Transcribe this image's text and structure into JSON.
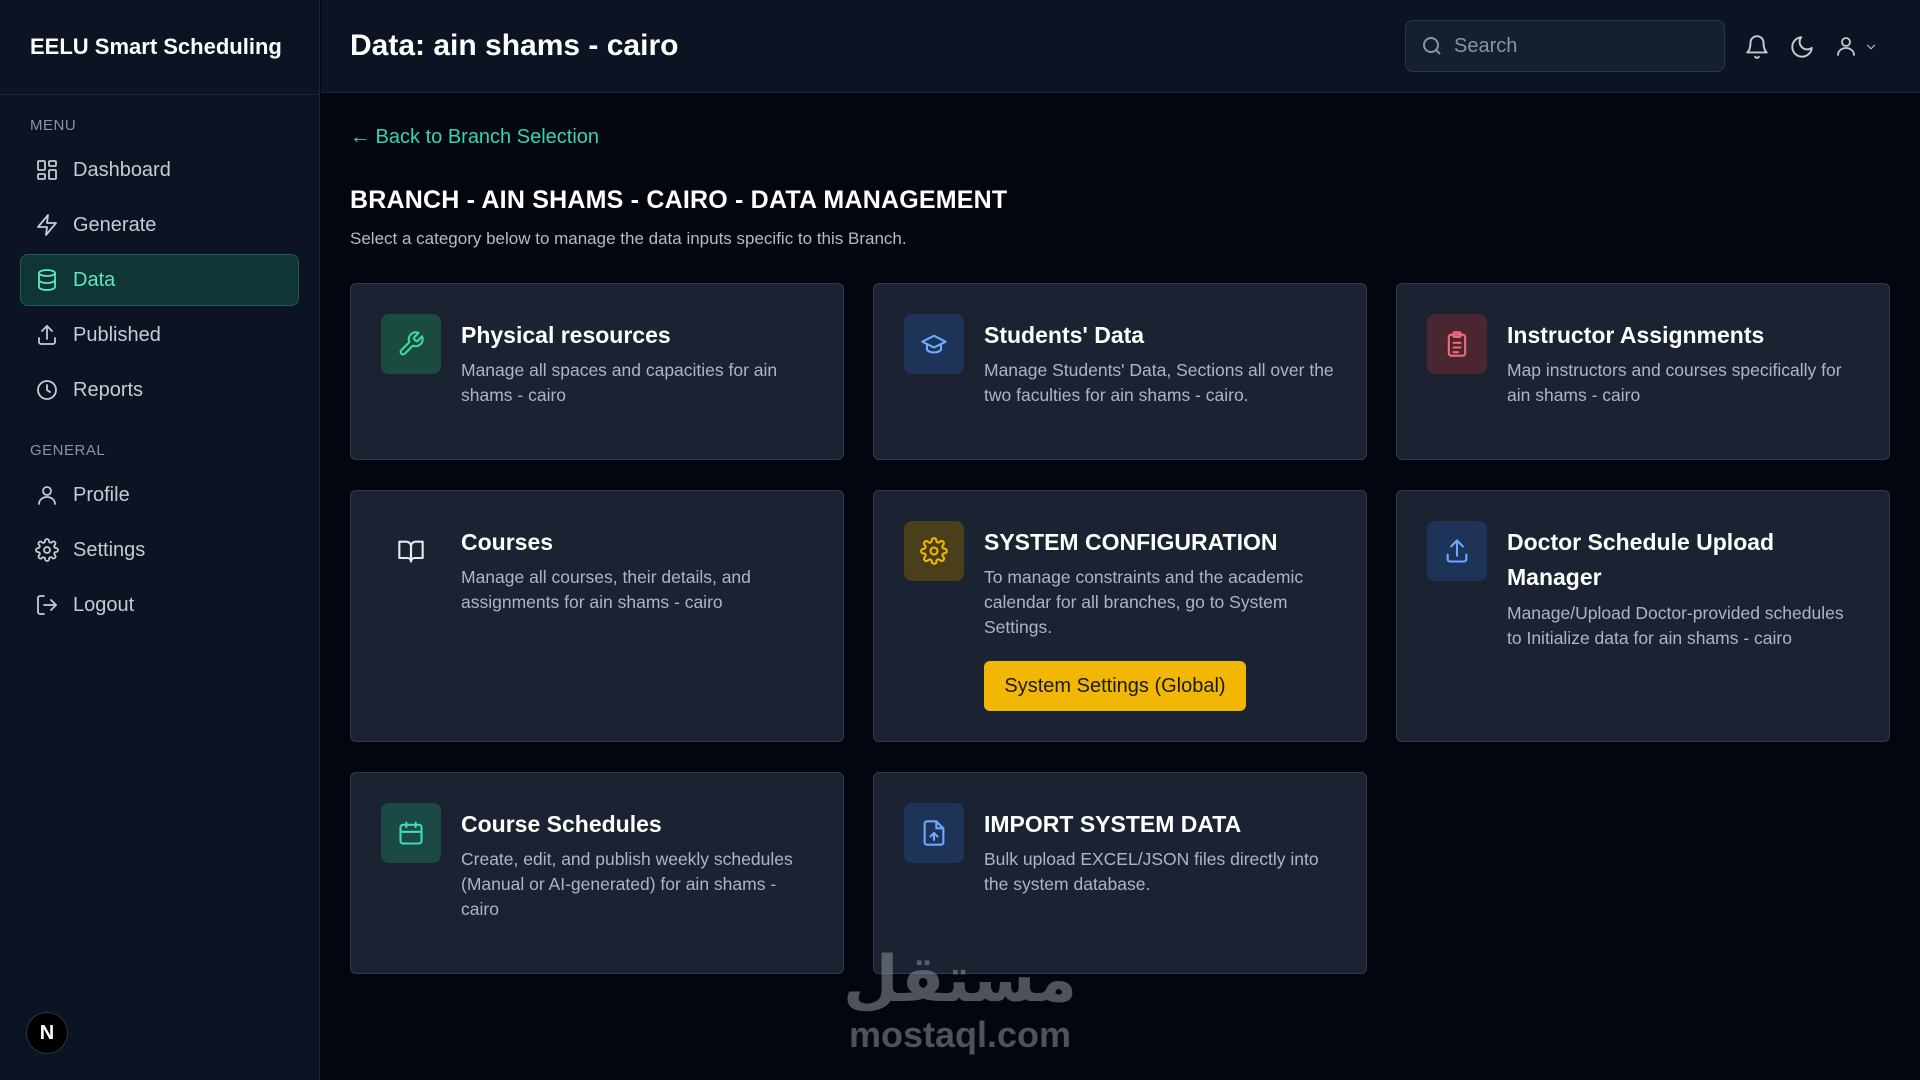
{
  "app": {
    "brand": "EELU Smart Scheduling"
  },
  "sidebar": {
    "menu_heading": "MENU",
    "general_heading": "GENERAL",
    "menu_items": [
      {
        "label": "Dashboard",
        "icon": "dashboard-icon"
      },
      {
        "label": "Generate",
        "icon": "lightning-icon"
      },
      {
        "label": "Data",
        "icon": "database-icon",
        "active": true
      },
      {
        "label": "Published",
        "icon": "upload-icon"
      },
      {
        "label": "Reports",
        "icon": "clock-icon"
      }
    ],
    "general_items": [
      {
        "label": "Profile",
        "icon": "user-icon"
      },
      {
        "label": "Settings",
        "icon": "gear-icon"
      },
      {
        "label": "Logout",
        "icon": "logout-icon"
      }
    ],
    "badge": "N"
  },
  "header": {
    "title": "Data: ain shams - cairo",
    "search_placeholder": "Search"
  },
  "main": {
    "back_link": "← Back to Branch Selection",
    "title": "BRANCH - AIN SHAMS - CAIRO - DATA MANAGEMENT",
    "subtitle": "Select a category below to manage the data inputs specific to this Branch.",
    "cards": [
      {
        "title": "Physical resources",
        "desc": "Manage all spaces and capacities for ain shams - cairo",
        "icon": "wrench-icon"
      },
      {
        "title": "Students' Data",
        "desc": "Manage Students' Data, Sections all over the two faculties for ain shams - cairo.",
        "icon": "graduation-cap-icon"
      },
      {
        "title": "Instructor Assignments",
        "desc": "Map instructors and courses specifically for ain shams - cairo",
        "icon": "clipboard-icon"
      },
      {
        "title": "Courses",
        "desc": "Manage all courses, their details, and assignments for ain shams - cairo",
        "icon": "book-icon"
      },
      {
        "title": "SYSTEM CONFIGURATION",
        "desc": "To manage constraints and the academic calendar for all branches, go to System Settings.",
        "icon": "gear-icon",
        "button": "System Settings (Global)"
      },
      {
        "title": "Doctor Schedule Upload Manager",
        "desc": "Manage/Upload Doctor-provided schedules to Initialize data for ain shams - cairo",
        "icon": "upload-icon"
      },
      {
        "title": "Course Schedules",
        "desc": "Create, edit, and publish weekly schedules (Manual or AI-generated) for ain shams - cairo",
        "icon": "calendar-icon"
      },
      {
        "title": "IMPORT SYSTEM DATA",
        "desc": "Bulk upload EXCEL/JSON files directly into the system database.",
        "icon": "file-upload-icon"
      }
    ]
  },
  "watermark": {
    "arabic": "مستقل",
    "latin": "mostaql.com"
  },
  "colors": {
    "accent": "#34d6b0",
    "button": "#f2b705",
    "card_bg": "#1b2332",
    "page_bg": "#03060e"
  }
}
